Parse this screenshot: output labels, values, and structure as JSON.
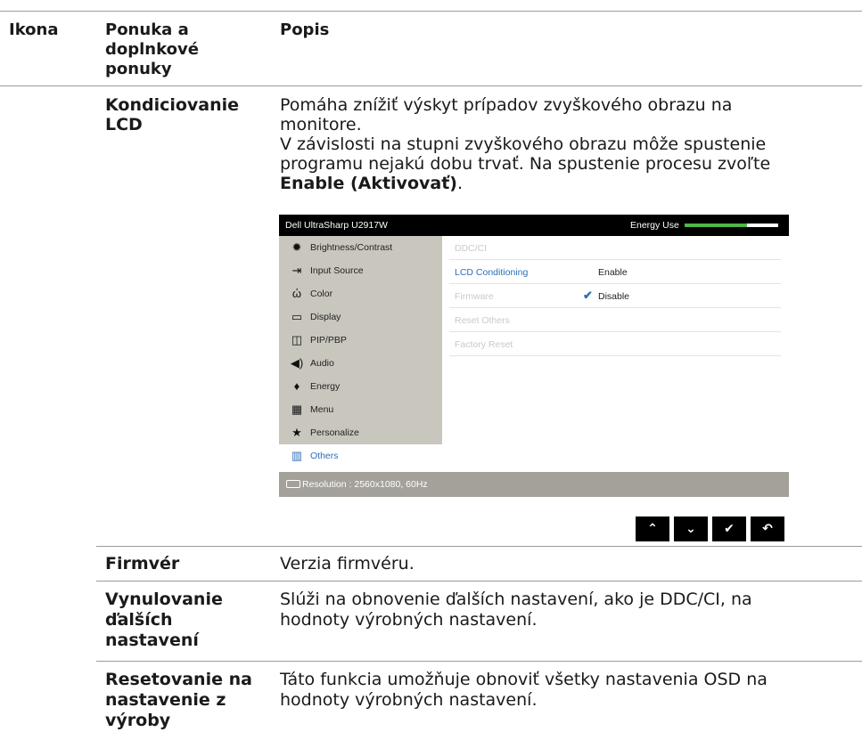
{
  "header": {
    "col1": "Ikona",
    "col2": "Ponuka a doplnkové ponuky",
    "col3": "Popis"
  },
  "header_lines": [
    "Ponuka a",
    "doplnkové",
    "ponuky"
  ],
  "rows": {
    "lcd": {
      "name_lines": [
        "Kondiciovanie",
        "LCD"
      ],
      "desc_lines": [
        "Pomáha znížiť výskyt prípadov zvyškového obrazu na",
        "monitore.",
        "V závislosti na stupni zvyškového obrazu môže spustenie",
        "programu nejakú dobu trvať. Na spustenie procesu zvoľte"
      ],
      "desc_bold": "Enable (Aktivovať)",
      "desc_end": "."
    },
    "firmware": {
      "name": "Firmvér",
      "desc": "Verzia firmvéru."
    },
    "reset_others": {
      "name_lines": [
        "Vynulovanie",
        "ďalších",
        "nastavení"
      ],
      "desc_lines": [
        "Slúži na obnovenie ďalších nastavení, ako je DDC/CI, na",
        "hodnoty výrobných nastavení."
      ]
    },
    "factory": {
      "name_lines": [
        "Resetovanie na",
        "nastavenie z",
        "výroby"
      ],
      "desc_lines": [
        "Táto funkcia umožňuje obnoviť všetky nastavenia OSD na",
        "hodnoty výrobných nastavení."
      ]
    }
  },
  "osd": {
    "title": "Dell UltraSharp U2917W",
    "energy_label": "Energy Use",
    "energy_level": 0.67,
    "accent": "#2a6fb8",
    "energy_color": "#4fb748",
    "menu": [
      {
        "label": "Brightness/Contrast",
        "icon": "brightness-icon"
      },
      {
        "label": "Input Source",
        "icon": "input-source-icon"
      },
      {
        "label": "Color",
        "icon": "color-icon"
      },
      {
        "label": "Display",
        "icon": "display-icon"
      },
      {
        "label": "PIP/PBP",
        "icon": "pip-icon"
      },
      {
        "label": "Audio",
        "icon": "audio-icon"
      },
      {
        "label": "Energy",
        "icon": "energy-icon"
      },
      {
        "label": "Menu",
        "icon": "menu-icon"
      },
      {
        "label": "Personalize",
        "icon": "star-icon"
      },
      {
        "label": "Others",
        "icon": "others-icon"
      }
    ],
    "submenu": [
      {
        "label": "DDC/CI",
        "value": ""
      },
      {
        "label": "LCD Conditioning",
        "value": "Enable"
      },
      {
        "label": "Firmware",
        "value": "Disable"
      },
      {
        "label": "Reset Others",
        "value": ""
      },
      {
        "label": "Factory Reset",
        "value": ""
      }
    ],
    "status": "Resolution : 2560x1080, 60Hz",
    "buttons": [
      "up-icon",
      "down-icon",
      "check-icon",
      "back-icon"
    ]
  }
}
